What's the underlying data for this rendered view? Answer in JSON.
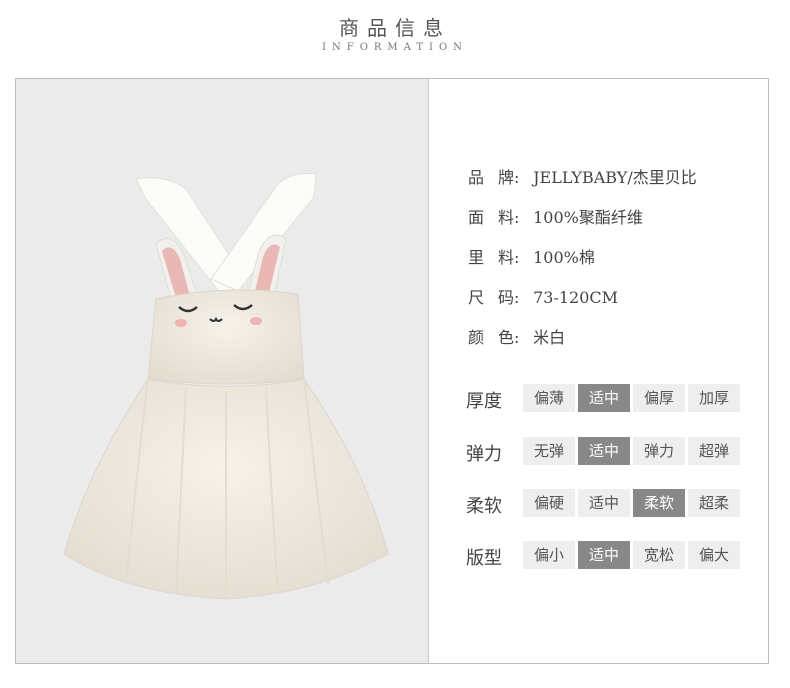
{
  "header": {
    "title": "商品信息",
    "subtitle": "INFORMATION"
  },
  "specs": [
    {
      "label_a": "品",
      "label_b": "牌",
      "value": "JELLYBABY/杰里贝比"
    },
    {
      "label_a": "面",
      "label_b": "料",
      "value": "100%聚酯纤维"
    },
    {
      "label_a": "里",
      "label_b": "料",
      "value": "100%棉"
    },
    {
      "label_a": "尺",
      "label_b": "码",
      "value": "73-120CM"
    },
    {
      "label_a": "颜",
      "label_b": "色",
      "value": "米白"
    }
  ],
  "colon": ":",
  "scales": [
    {
      "name": "厚度",
      "options": [
        "偏薄",
        "适中",
        "偏厚",
        "加厚"
      ],
      "selected": 1
    },
    {
      "name": "弹力",
      "options": [
        "无弹",
        "适中",
        "弹力",
        "超弹"
      ],
      "selected": 1
    },
    {
      "name": "柔软",
      "options": [
        "偏硬",
        "适中",
        "柔软",
        "超柔"
      ],
      "selected": 2
    },
    {
      "name": "版型",
      "options": [
        "偏小",
        "适中",
        "宽松",
        "偏大"
      ],
      "selected": 1
    }
  ],
  "colors": {
    "selected_bg": "#888888",
    "option_bg": "#eeeeee",
    "photo_bg": "#ebebeb"
  },
  "image": {
    "description_icon": "bunny-pinafore-dress-photo"
  }
}
